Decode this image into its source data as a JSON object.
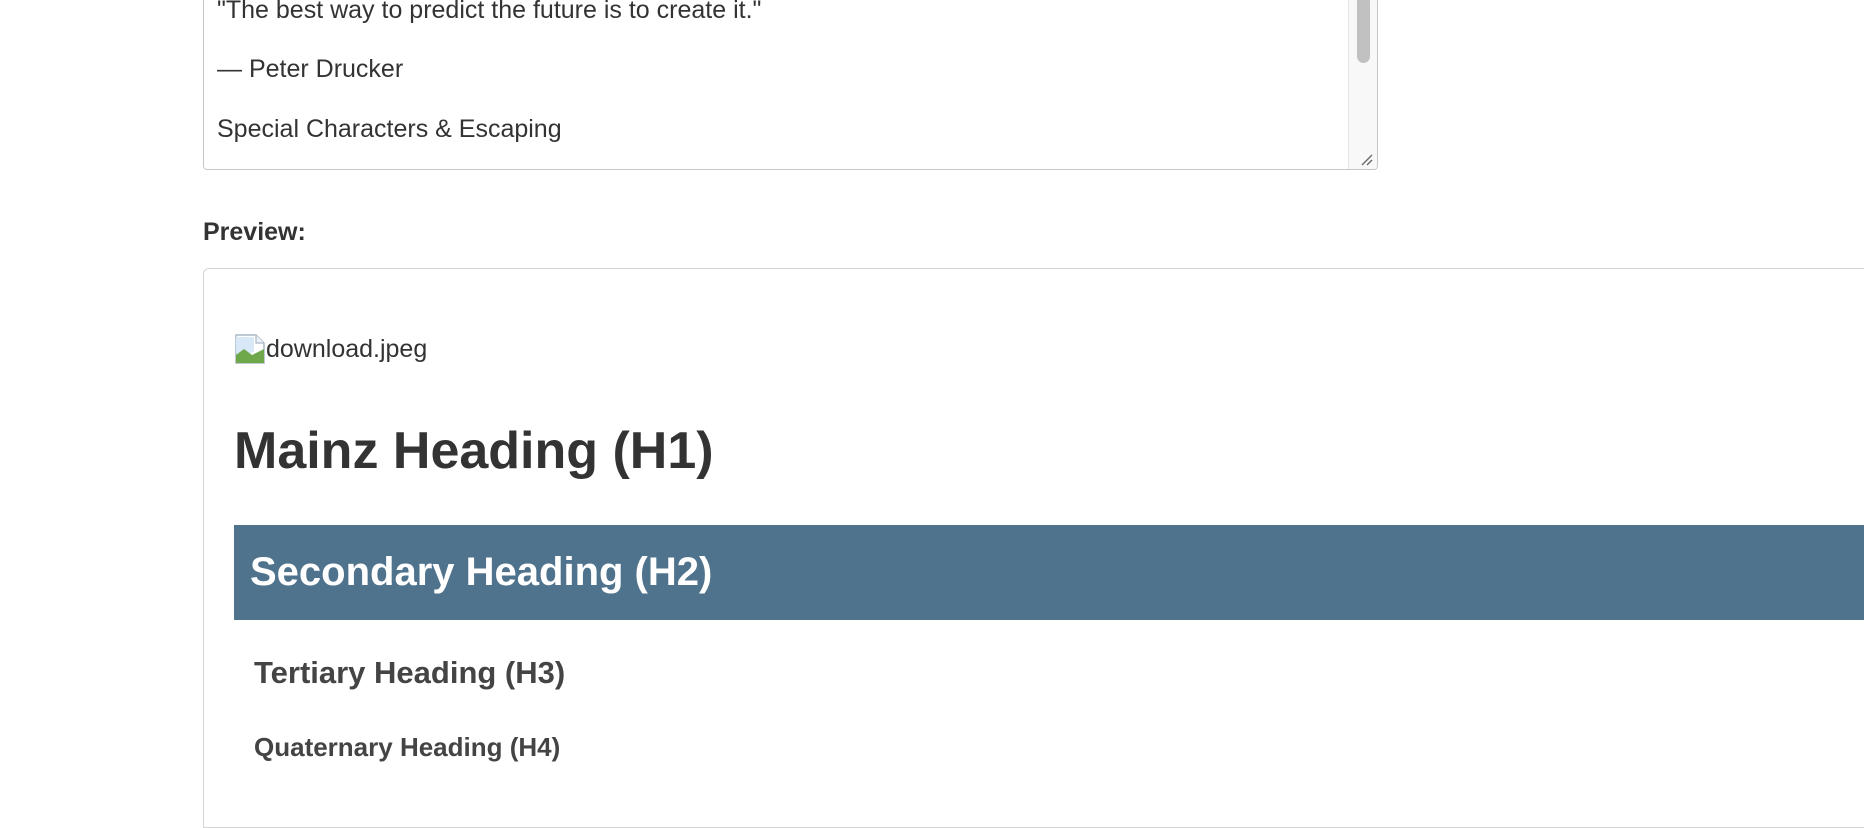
{
  "editor": {
    "lines": [
      "\"The best way to predict the future is to create it.\"",
      "— Peter Drucker",
      "Special Characters & Escaping"
    ]
  },
  "preview": {
    "label": "Preview:",
    "image_alt": "download.jpeg",
    "h1": "Mainz Heading (H1)",
    "h2": "Secondary Heading (H2)",
    "h3": "Tertiary Heading (H3)",
    "h4": "Quaternary Heading (H4)"
  },
  "colors": {
    "h2_background": "#4f738c",
    "text": "#333333",
    "border": "#c7c7c7"
  },
  "icons": {
    "broken_image": "broken-image-icon",
    "resize_grip": "resize-grip-icon"
  }
}
